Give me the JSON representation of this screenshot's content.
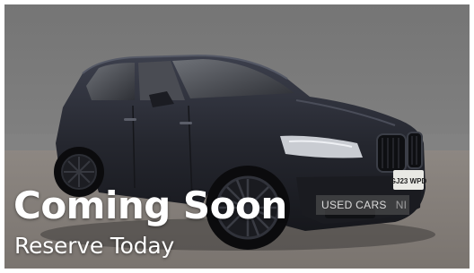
{
  "listing": {
    "headline": "Coming Soon",
    "subline": "Reserve Today",
    "watermark": "USED CARS",
    "watermark_suffix": "NI",
    "plate": "GJ23 WPD"
  }
}
